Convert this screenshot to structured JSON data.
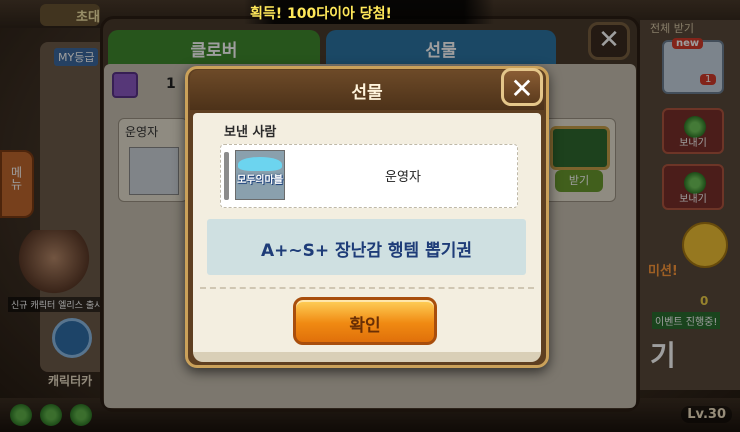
{
  "announcement": "획득! 100다이아 당첨!",
  "background": {
    "title": "초대",
    "my_label": "MY등급",
    "menu_label": "메뉴",
    "character_caption": "신규 캐릭터 엘리스 출시",
    "character_button": "캐릭터카",
    "level": "Lv.30",
    "right_top": "전체 받기",
    "mail_new": "new",
    "mail_count": "1",
    "send_label": "보내기",
    "event_text": "미션!",
    "event_banner": "이벤트 진행중!",
    "key_count": "0",
    "big_text": "기"
  },
  "gift_window": {
    "tabs": [
      {
        "label": "클로버"
      },
      {
        "label": "선물"
      }
    ],
    "gift_count": "1",
    "item_sender": "운영자",
    "chest_button": "받기"
  },
  "popup": {
    "title": "선물",
    "sender_label": "보낸 사람",
    "sender_logo_text": "모두의마블",
    "sender_name": "운영자",
    "item_name": "A+~S+ 장난감 행템 뽑기권",
    "confirm_label": "확인"
  },
  "colors": {
    "accent_orange": "#f08a12",
    "title_blue": "#1e3c78",
    "frame_gold": "#caa15a"
  }
}
